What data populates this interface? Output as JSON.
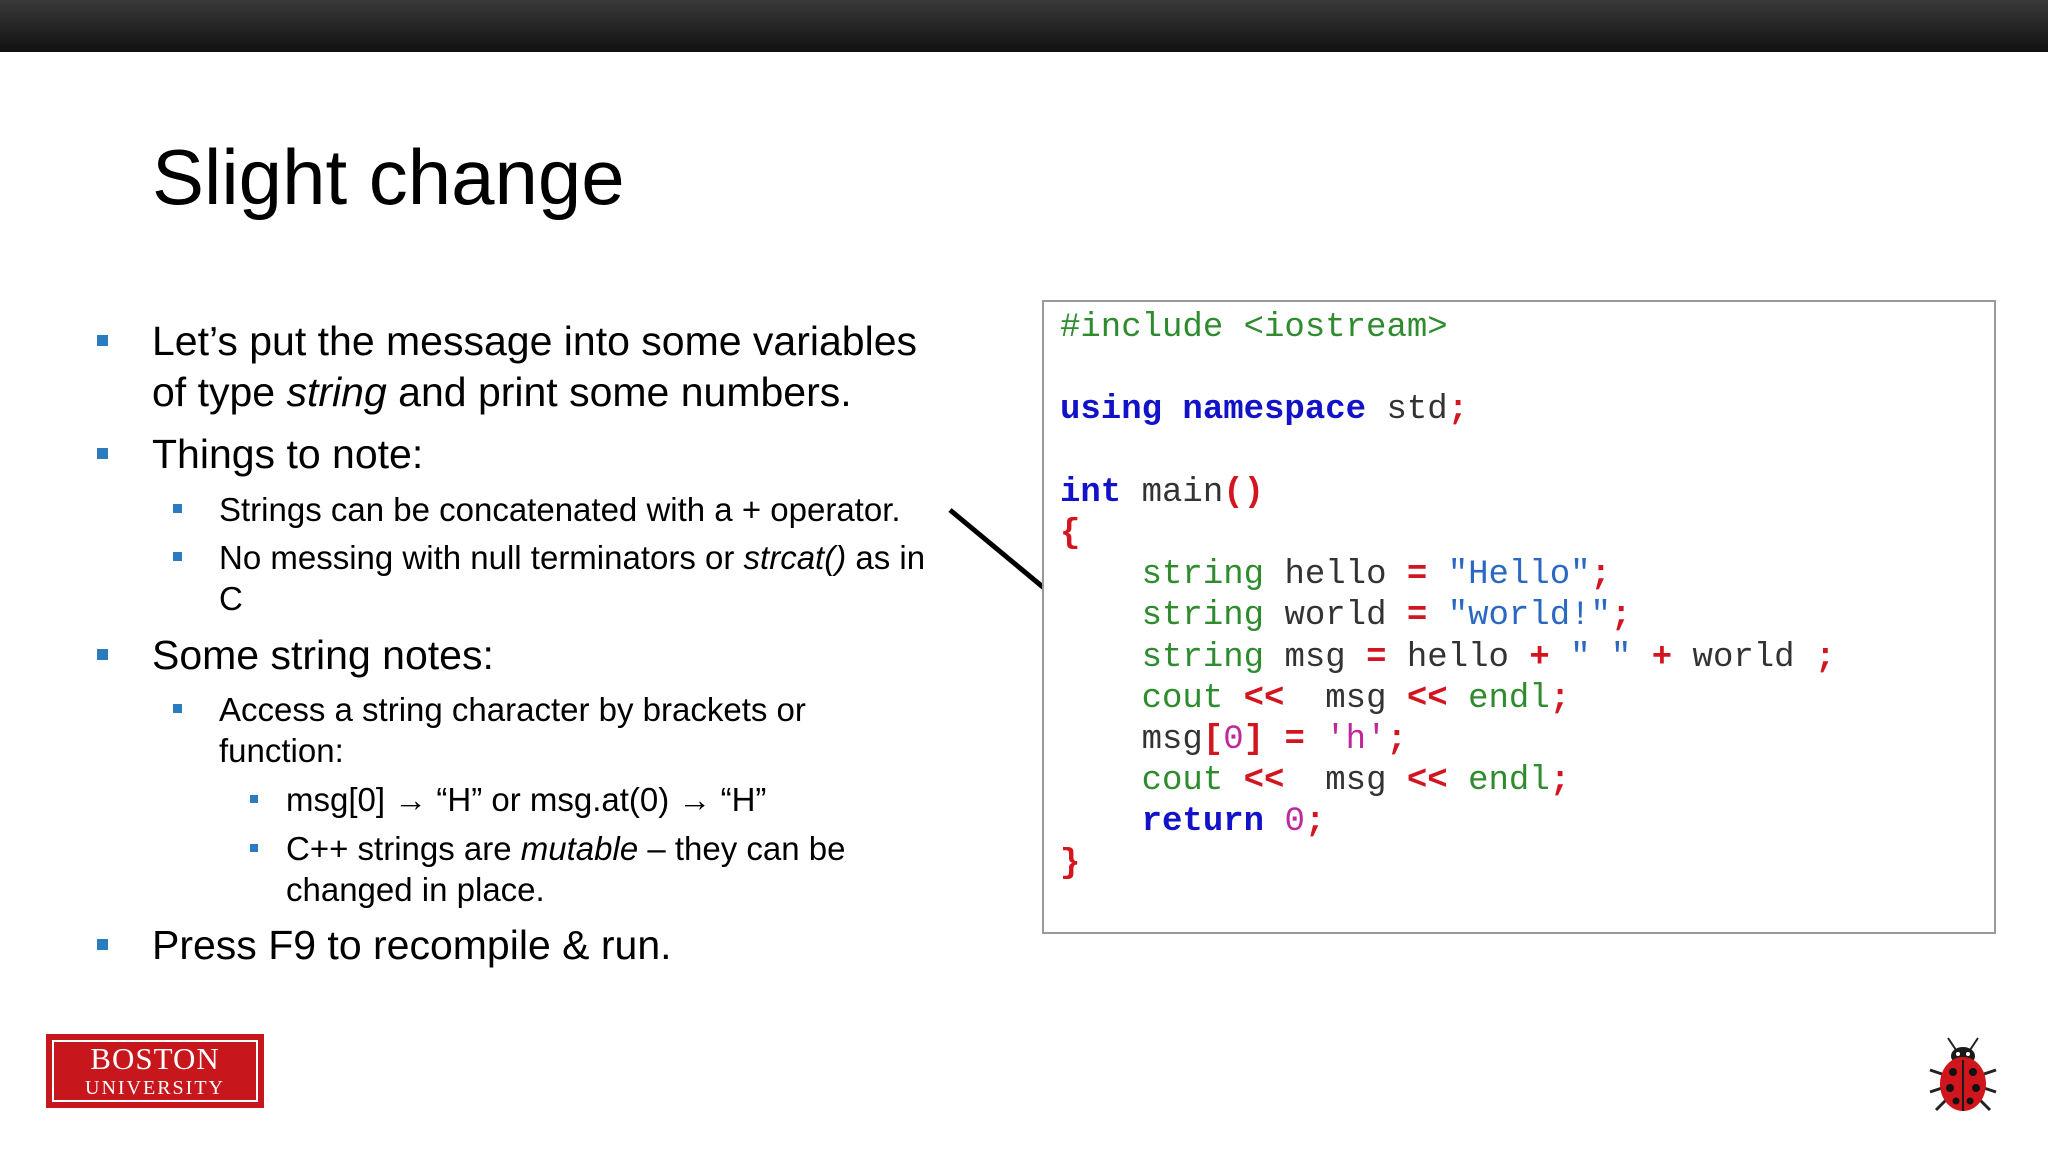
{
  "slide": {
    "title": "Slight change"
  },
  "bullets": {
    "b1": {
      "line1": "Let’s put the message into some variables",
      "l2a": "of type ",
      "l2b": "string",
      "l2c": " and print some numbers."
    },
    "b2": "Things to note:",
    "b2a": "Strings can be concatenated with a + operator.",
    "b2b": {
      "a": "No messing with null terminators or ",
      "b": "strcat()",
      "c": " as in",
      "d": "C"
    },
    "b3": "Some string notes:",
    "b3a": {
      "line1": "Access a string character by brackets or",
      "line2": "function:"
    },
    "b3a1": {
      "a": "msg[0] ",
      "arrow1": "→",
      "b": " “H”  or msg.at(0) ",
      "arrow2": "→",
      "c": " “H”"
    },
    "b3a2": {
      "a": "C++ strings are ",
      "b": "mutable",
      "c": " – they can be",
      "d": "changed in place."
    },
    "b4": "Press F9 to recompile & run."
  },
  "code": {
    "include": "#include <iostream>",
    "using_kw": "using namespace",
    "using_rest": " std",
    "int_kw": "int",
    "main": " main",
    "string_kw": "string",
    "hello_var": " hello ",
    "hello_str": "\"Hello\"",
    "world_var": " world ",
    "world_str": "\"world!\"",
    "msg_var": " msg ",
    "msg_expr_a": " hello ",
    "msg_space_str": "\" \"",
    "msg_expr_b": " world ",
    "cout": "cout",
    "endl": "endl",
    "msg": "msg",
    "msg_idx": "0",
    "char_lit": "'h'",
    "return_kw": "return",
    "zero": "0"
  },
  "logo": {
    "line1": "BOSTON",
    "line2": "UNIVERSITY"
  },
  "colors": {
    "bullet": "#2b7bbf",
    "keyword": "#1212c8",
    "type": "#2e8b2e",
    "string": "#2a68c2",
    "operator": "#d3151f",
    "number": "#c0289a",
    "logo_red": "#c8161d"
  },
  "icons": {
    "bullet": "square-bullet-icon",
    "pointer": "arrow-icon",
    "mascot": "ladybug-icon"
  }
}
